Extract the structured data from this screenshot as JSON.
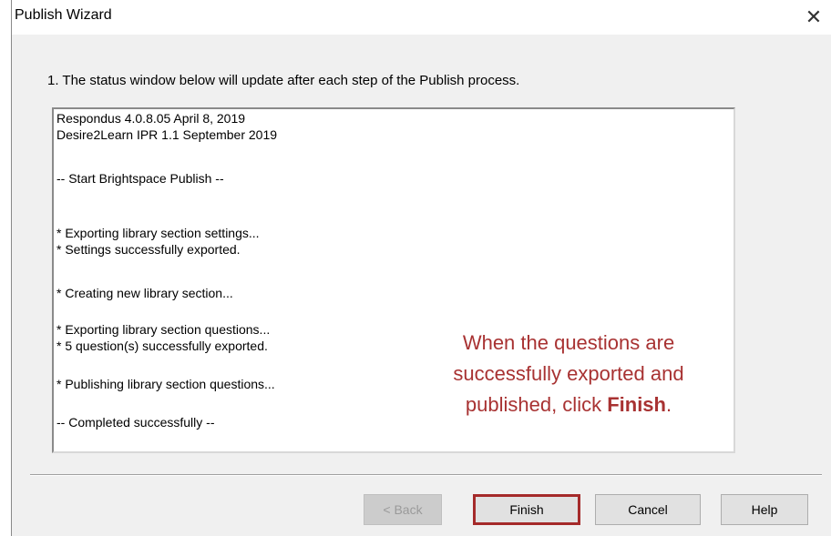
{
  "window": {
    "title": "Publish Wizard",
    "close_glyph": "✕"
  },
  "step_text": "1.  The status window below will update after each step of the Publish process.",
  "status_log": [
    "Respondus 4.0.8.05  April 8, 2019",
    "Desire2Learn IPR 1.1   September 2019",
    "-- Start Brightspace Publish --",
    "* Exporting library section settings...",
    "* Settings successfully exported.",
    "* Creating new library section...",
    "* Exporting library section questions...",
    "* 5 question(s) successfully exported.",
    "* Publishing library section questions...",
    "-- Completed successfully --"
  ],
  "callout": {
    "line1": "When the questions are",
    "line2": "successfully exported and",
    "line3_prefix": "published, click ",
    "line3_bold": "Finish",
    "line3_suffix": ".",
    "color": "#a83232"
  },
  "buttons": {
    "back": "< Back",
    "finish": "Finish",
    "cancel": "Cancel",
    "help": "Help"
  }
}
